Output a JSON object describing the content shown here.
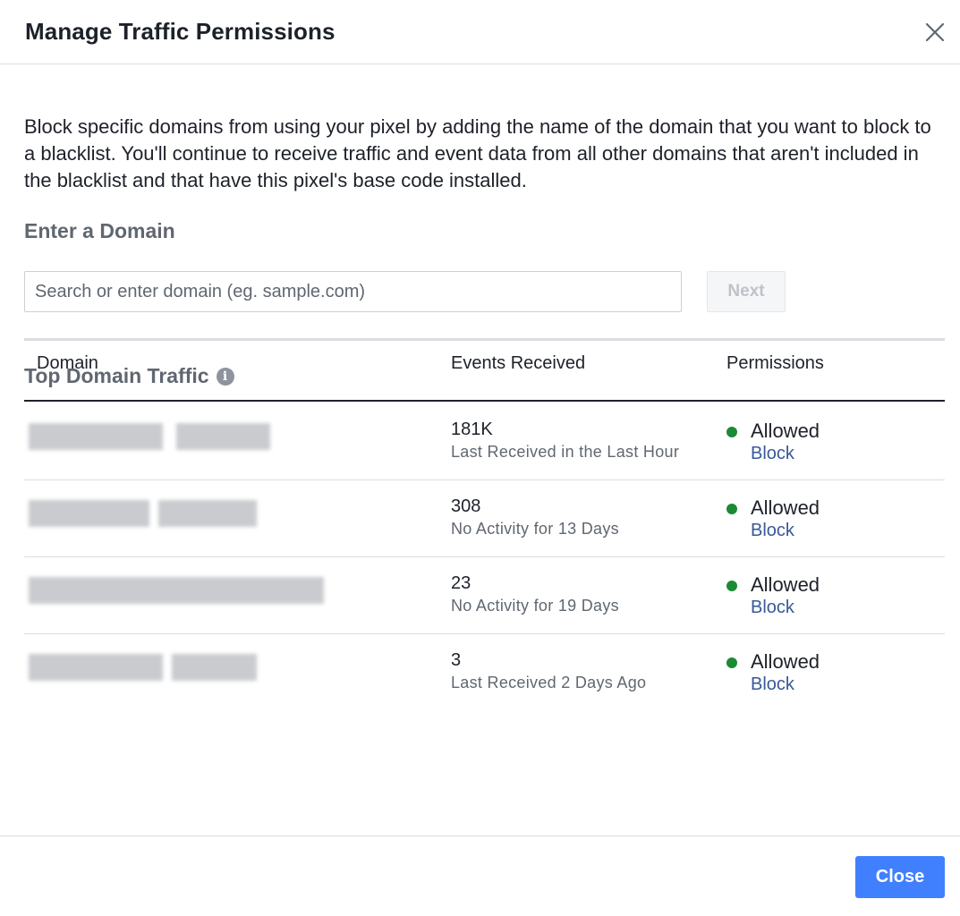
{
  "dialog": {
    "title": "Manage Traffic Permissions",
    "description": "Block specific domains from using your pixel by adding the name of the domain that you want to block to a blacklist. You'll continue to receive traffic and event data from all other domains that aren't included in the blacklist and that have this pixel's base code installed."
  },
  "enter_domain": {
    "heading": "Enter a Domain",
    "placeholder": "Search or enter domain (eg. sample.com)",
    "next_label": "Next"
  },
  "top_traffic": {
    "heading": "Top Domain Traffic",
    "info_icon": "i",
    "columns": [
      "Domain",
      "Events Received",
      "Permissions"
    ],
    "rows": [
      {
        "events": "181K",
        "last": "Last Received in the Last Hour",
        "status": "Allowed",
        "action": "Block"
      },
      {
        "events": "308",
        "last": "No Activity for 13 Days",
        "status": "Allowed",
        "action": "Block"
      },
      {
        "events": "23",
        "last": "No Activity for 19 Days",
        "status": "Allowed",
        "action": "Block"
      },
      {
        "events": "3",
        "last": "Last Received 2 Days Ago",
        "status": "Allowed",
        "action": "Block"
      }
    ]
  },
  "footer": {
    "close_label": "Close"
  },
  "colors": {
    "accent": "#4080ff",
    "link": "#385898",
    "allowed_dot": "#1b8a34",
    "secondary_text": "#606770"
  },
  "icons": {
    "close": "close-icon",
    "info": "info-icon",
    "status": "status-dot-icon"
  }
}
